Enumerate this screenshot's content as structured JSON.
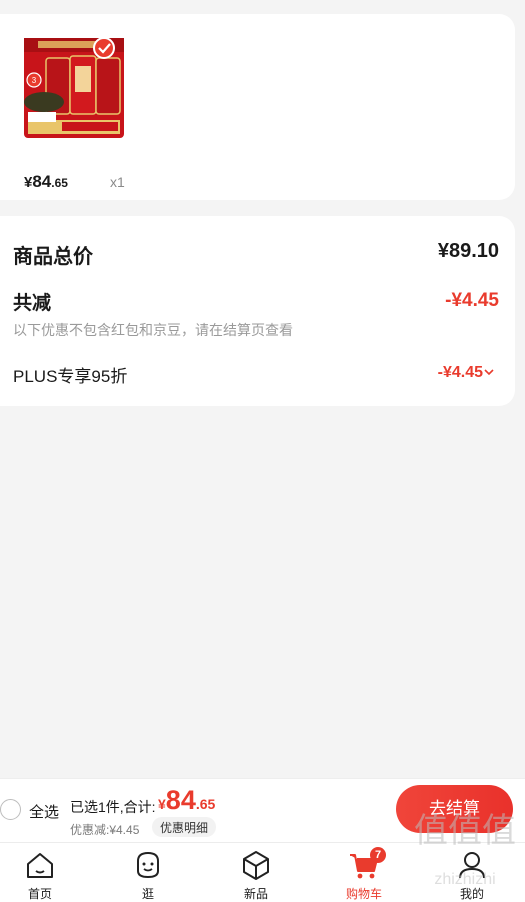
{
  "product": {
    "price_currency": "¥",
    "price_integer": "84",
    "price_decimal": ".65",
    "quantity": "x1",
    "thumbnail_icon": "tea-product-image",
    "thumbnail_badge_count": "3"
  },
  "summary": {
    "total_label": "商品总价",
    "total_value": "¥89.10",
    "discount_label": "共减",
    "discount_value": "-¥4.45",
    "discount_note": "以下优惠不包含红包和京豆，请在结算页查看",
    "plus_label": "PLUS专享95折",
    "plus_value": "-¥4.45"
  },
  "checkout": {
    "select_all_label": "全选",
    "selected_text": "已选1件,合计:",
    "total_currency": "¥",
    "total_integer": "84",
    "total_decimal": ".65",
    "saved_text": "优惠减:¥4.45",
    "detail_button": "优惠明细",
    "checkout_button": "去结算"
  },
  "tabbar": {
    "items": [
      {
        "label": "首页",
        "icon": "home-icon"
      },
      {
        "label": "逛",
        "icon": "discover-icon"
      },
      {
        "label": "新品",
        "icon": "new-products-icon"
      },
      {
        "label": "购物车",
        "icon": "cart-icon",
        "badge": "7"
      },
      {
        "label": "我的",
        "icon": "profile-icon"
      }
    ],
    "active": "购物车"
  },
  "watermark": {
    "text": "值值值",
    "url_text": "zhizhizhi"
  },
  "colors": {
    "accent": "#e93b2d",
    "background": "#f4f4f4",
    "card": "#ffffff",
    "muted_text": "#9a9a9a"
  }
}
